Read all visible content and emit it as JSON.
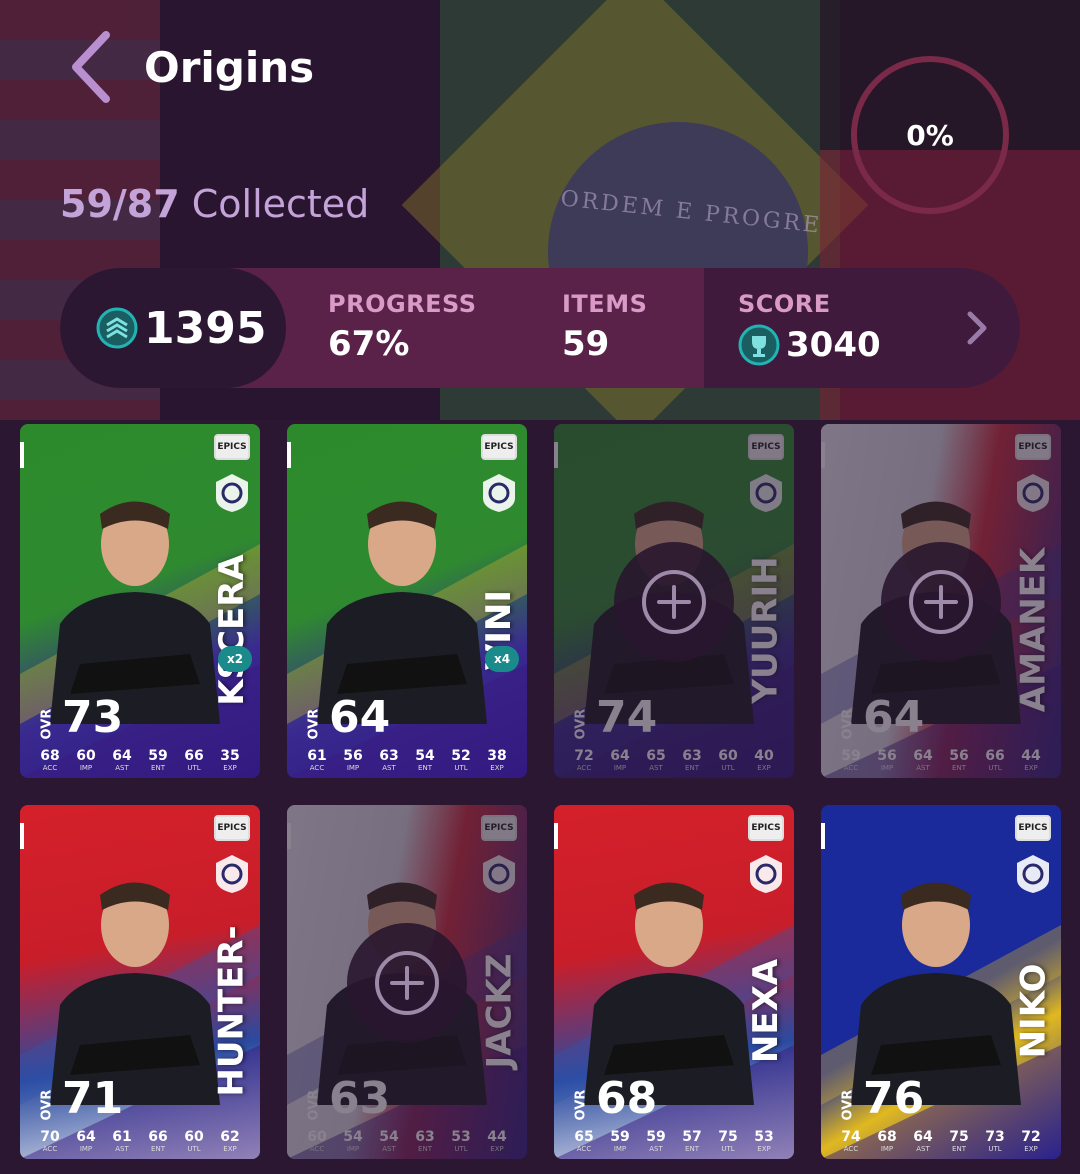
{
  "header": {
    "title": "Origins"
  },
  "progress_ring": {
    "percent_label": "0%",
    "percent": 0
  },
  "collected": {
    "count": "59/87",
    "label": "Collected"
  },
  "stats": {
    "coins": "1395",
    "progress_label": "PROGRESS",
    "progress_value": "67%",
    "items_label": "ITEMS",
    "items_value": "59",
    "score_label": "SCORE",
    "score_value": "3040"
  },
  "cards": [
    {
      "name": "KSCERATO",
      "name_visible": "KSCERA",
      "ovr_label": "OVR",
      "ovr": "73",
      "duplicates": "x2",
      "locked": false,
      "theme": "brazil",
      "attrs": [
        {
          "v": "68",
          "k": "ACC"
        },
        {
          "v": "60",
          "k": "IMP"
        },
        {
          "v": "64",
          "k": "AST"
        },
        {
          "v": "59",
          "k": "ENT"
        },
        {
          "v": "66",
          "k": "UTL"
        },
        {
          "v": "35",
          "k": "EXP"
        }
      ]
    },
    {
      "name": "VINI",
      "name_visible": "VINI",
      "ovr_label": "OVR",
      "ovr": "64",
      "duplicates": "x4",
      "locked": false,
      "theme": "brazil",
      "attrs": [
        {
          "v": "61",
          "k": "ACC"
        },
        {
          "v": "56",
          "k": "IMP"
        },
        {
          "v": "63",
          "k": "AST"
        },
        {
          "v": "54",
          "k": "ENT"
        },
        {
          "v": "52",
          "k": "UTL"
        },
        {
          "v": "38",
          "k": "EXP"
        }
      ]
    },
    {
      "name": "YUURIH",
      "name_visible": "YUURIH",
      "ovr_label": "OVR",
      "ovr": "74",
      "duplicates": "",
      "locked": true,
      "theme": "brazil",
      "attrs": [
        {
          "v": "72",
          "k": "ACC"
        },
        {
          "v": "64",
          "k": "IMP"
        },
        {
          "v": "65",
          "k": "AST"
        },
        {
          "v": "63",
          "k": "ENT"
        },
        {
          "v": "60",
          "k": "UTL"
        },
        {
          "v": "40",
          "k": "EXP"
        }
      ]
    },
    {
      "name": "AMANEK",
      "name_visible": "AMANEK",
      "ovr_label": "OVR",
      "ovr": "64",
      "duplicates": "",
      "locked": true,
      "theme": "france",
      "attrs": [
        {
          "v": "59",
          "k": "ACC"
        },
        {
          "v": "56",
          "k": "IMP"
        },
        {
          "v": "64",
          "k": "AST"
        },
        {
          "v": "56",
          "k": "ENT"
        },
        {
          "v": "66",
          "k": "UTL"
        },
        {
          "v": "44",
          "k": "EXP"
        }
      ]
    },
    {
      "name": "HUNTER-",
      "name_visible": "HUNTER-",
      "ovr_label": "OVR",
      "ovr": "71",
      "duplicates": "",
      "locked": false,
      "theme": "serbia",
      "attrs": [
        {
          "v": "70",
          "k": "ACC"
        },
        {
          "v": "64",
          "k": "IMP"
        },
        {
          "v": "61",
          "k": "AST"
        },
        {
          "v": "66",
          "k": "ENT"
        },
        {
          "v": "60",
          "k": "UTL"
        },
        {
          "v": "62",
          "k": "EXP"
        }
      ]
    },
    {
      "name": "JACKZ",
      "name_visible": "JACKZ",
      "ovr_label": "OVR",
      "ovr": "63",
      "duplicates": "",
      "locked": true,
      "theme": "france",
      "attrs": [
        {
          "v": "60",
          "k": "ACC"
        },
        {
          "v": "54",
          "k": "IMP"
        },
        {
          "v": "54",
          "k": "AST"
        },
        {
          "v": "63",
          "k": "ENT"
        },
        {
          "v": "53",
          "k": "UTL"
        },
        {
          "v": "44",
          "k": "EXP"
        }
      ]
    },
    {
      "name": "NEXA",
      "name_visible": "NEXA",
      "ovr_label": "OVR",
      "ovr": "68",
      "duplicates": "",
      "locked": false,
      "theme": "serbia",
      "attrs": [
        {
          "v": "65",
          "k": "ACC"
        },
        {
          "v": "59",
          "k": "IMP"
        },
        {
          "v": "59",
          "k": "AST"
        },
        {
          "v": "57",
          "k": "ENT"
        },
        {
          "v": "75",
          "k": "UTL"
        },
        {
          "v": "53",
          "k": "EXP"
        }
      ]
    },
    {
      "name": "NIKO",
      "name_visible": "NIKO",
      "ovr_label": "OVR",
      "ovr": "76",
      "duplicates": "",
      "locked": false,
      "theme": "bosnia",
      "attrs": [
        {
          "v": "74",
          "k": "ACC"
        },
        {
          "v": "68",
          "k": "IMP"
        },
        {
          "v": "64",
          "k": "AST"
        },
        {
          "v": "75",
          "k": "ENT"
        },
        {
          "v": "73",
          "k": "UTL"
        },
        {
          "v": "72",
          "k": "EXP"
        }
      ]
    }
  ],
  "badge_text": "EPICS",
  "colors": {
    "accent": "#c4a4d8",
    "teal": "#19a5a5",
    "bar": "#5a2149",
    "bg": "#2c1733"
  }
}
